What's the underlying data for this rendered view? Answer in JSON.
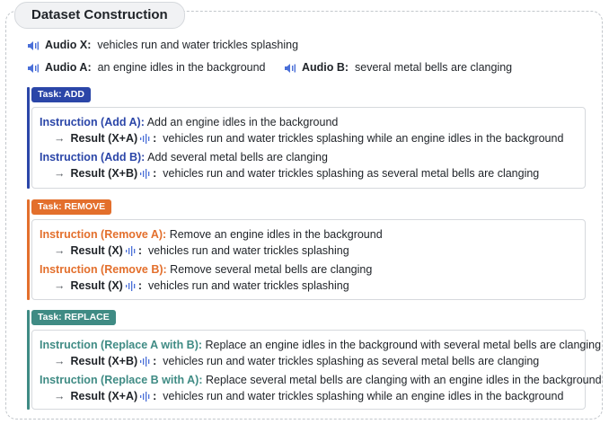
{
  "title": "Dataset Construction",
  "audio": {
    "x": {
      "label": "Audio X:",
      "text": "vehicles run and water trickles splashing"
    },
    "a": {
      "label": "Audio A:",
      "text": "an engine idles in the background"
    },
    "b": {
      "label": "Audio B:",
      "text": "several metal bells are clanging"
    }
  },
  "colors": {
    "add": "#2b46a8",
    "remove": "#e36f2c",
    "replace": "#3f8b84",
    "icon": "#4a6fd8"
  },
  "tasks": {
    "add": {
      "badge": "Task: ADD",
      "items": [
        {
          "instr_label": "Instruction (Add A):",
          "instr_text": "Add an engine idles in the background",
          "result_label": "Result (X+A)",
          "result_text": "vehicles run and water trickles splashing while an engine idles in the background"
        },
        {
          "instr_label": "Instruction (Add B):",
          "instr_text": "Add several metal bells are clanging",
          "result_label": "Result (X+B)",
          "result_text": "vehicles run and water trickles splashing as several metal bells are clanging"
        }
      ]
    },
    "remove": {
      "badge": "Task: REMOVE",
      "items": [
        {
          "instr_label": "Instruction (Remove A):",
          "instr_text": "Remove an engine idles in the background",
          "result_label": "Result (X)",
          "result_text": "vehicles run and water trickles splashing"
        },
        {
          "instr_label": "Instruction (Remove B):",
          "instr_text": "Remove several metal bells are clanging",
          "result_label": "Result (X)",
          "result_text": "vehicles run and water trickles splashing"
        }
      ]
    },
    "replace": {
      "badge": "Task: REPLACE",
      "items": [
        {
          "instr_label": "Instruction (Replace A with B):",
          "instr_text": "Replace an engine idles in the background with several metal bells are clanging",
          "result_label": "Result (X+B)",
          "result_text": "vehicles run and water trickles splashing as several metal bells are clanging"
        },
        {
          "instr_label": "Instruction (Replace B with A):",
          "instr_text": "Replace several metal bells are clanging with an engine idles in the background",
          "result_label": "Result (X+A)",
          "result_text": "vehicles run and water trickles splashing while an engine idles in the background"
        }
      ]
    }
  },
  "icons": {
    "speaker": "speaker-icon",
    "waveform": "waveform-icon",
    "arrow": "right-arrow-icon"
  },
  "glyphs": {
    "arrow": "→",
    "colon": ":"
  }
}
